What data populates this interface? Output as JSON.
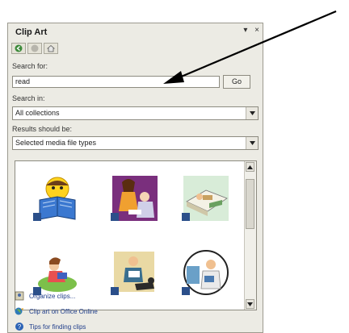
{
  "pane": {
    "title": "Clip Art",
    "controls": {
      "menu": "▾",
      "close": "×"
    },
    "search_label": "Search for:",
    "search_value": "read",
    "go_label": "Go",
    "search_in_label": "Search in:",
    "search_in_value": "All collections",
    "results_label": "Results should be:",
    "results_value": "Selected media file types",
    "links": [
      {
        "label": "Organize clips...",
        "icon": "organize-clips-icon"
      },
      {
        "label": "Clip art on Office Online",
        "icon": "office-online-icon"
      },
      {
        "label": "Tips for finding clips",
        "icon": "tips-icon"
      }
    ],
    "thumbnails": [
      "emoji-reading-book-clip",
      "woman-reading-to-elderly-clip",
      "person-reading-in-bed-clip",
      "girl-reading-on-grass-clip",
      "man-reading-with-dog-clip",
      "doctor-reading-clip"
    ]
  }
}
